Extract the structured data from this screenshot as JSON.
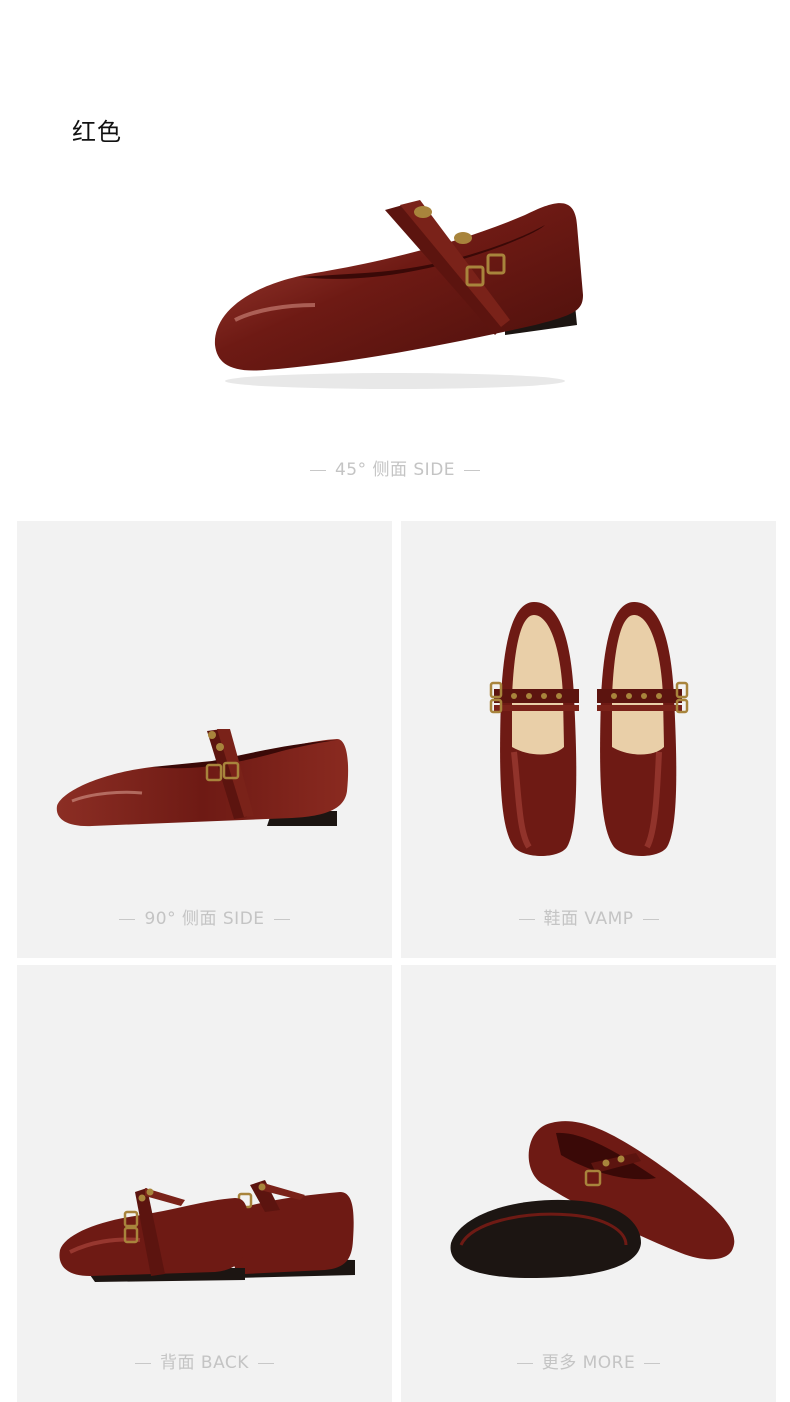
{
  "color_title": "红色",
  "views": [
    {
      "label": "45°  侧面 SIDE"
    },
    {
      "label": "90°  侧面 SIDE"
    },
    {
      "label": "鞋面 VAMP"
    },
    {
      "label": "背面 BACK"
    },
    {
      "label": "更多 MORE"
    }
  ],
  "colors": {
    "leather": "#6e1a14",
    "leather_highlight": "#a8453a",
    "buckle": "#a8843c",
    "panel_bg": "#f2f2f2",
    "caption": "#c4c4c4",
    "insole": "#e9cfa8"
  }
}
